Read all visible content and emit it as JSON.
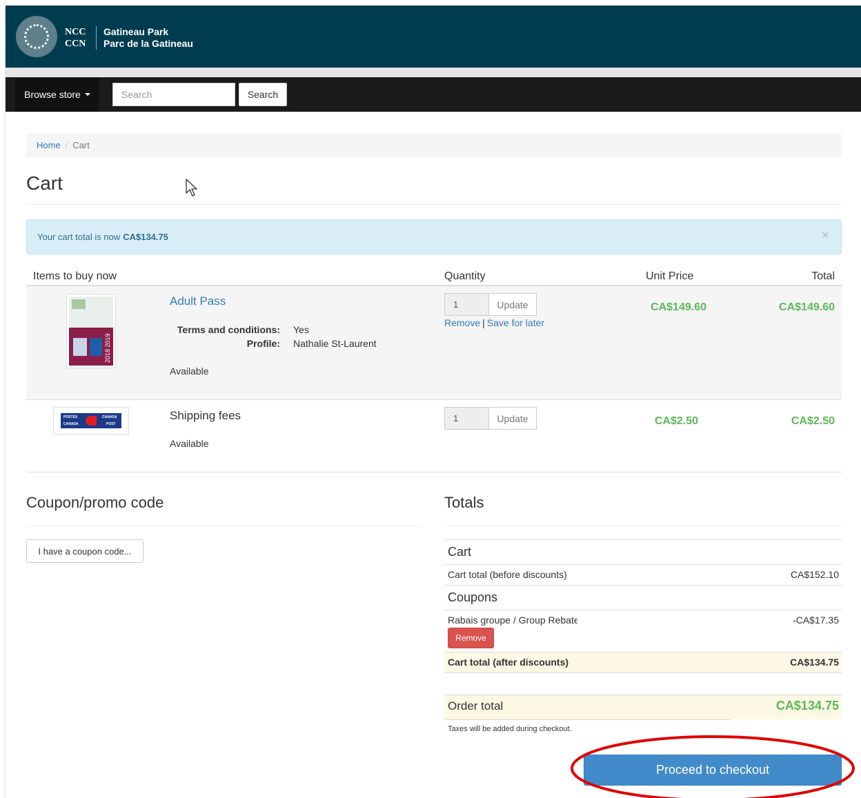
{
  "header": {
    "brand_abbr_en": "NCC",
    "brand_abbr_fr": "CCN",
    "brand_name_en": "Gatineau Park",
    "brand_name_fr": "Parc de la Gatineau",
    "logo_icon": "ncc-logo-icon",
    "color": "#003c4f"
  },
  "nav": {
    "browse_label": "Browse store",
    "search_placeholder": "Search",
    "search_button": "Search"
  },
  "breadcrumb": {
    "home": "Home",
    "separator": "/",
    "current": "Cart"
  },
  "page": {
    "title": "Cart"
  },
  "alert": {
    "text": "Your cart total is now ",
    "amount": "CA$134.75",
    "close": "×"
  },
  "table": {
    "headers": {
      "items": "Items to buy now",
      "quantity": "Quantity",
      "unit_price": "Unit Price",
      "total": "Total"
    },
    "rows": [
      {
        "name": "Adult Pass",
        "image_icon": "adult-pass-card-icon",
        "options": [
          {
            "label": "Terms and conditions:",
            "value": "Yes"
          },
          {
            "label": "Profile:",
            "value": "Nathalie St-Laurent"
          }
        ],
        "availability": "Available",
        "quantity": "1",
        "update_label": "Update",
        "remove_label": "Remove",
        "link_sep": "|",
        "save_label": "Save for later",
        "unit_price": "CA$149.60",
        "total": "CA$149.60"
      },
      {
        "name": "Shipping fees",
        "image_icon": "canada-post-logo-icon",
        "availability": "Available",
        "quantity": "1",
        "update_label": "Update",
        "unit_price": "CA$2.50",
        "total": "CA$2.50"
      }
    ],
    "price_color": "#5cb85c"
  },
  "coupon": {
    "heading": "Coupon/promo code",
    "button": "I have a coupon code..."
  },
  "totals": {
    "heading": "Totals",
    "cart_group": "Cart",
    "cart_before_label": "Cart total (before discounts)",
    "cart_before_value": "CA$152.10",
    "coupons_group": "Coupons",
    "coupon_name": "Rabais groupe / Group Rebate",
    "coupon_value": "-CA$17.35",
    "coupon_remove": "Remove",
    "cart_after_label": "Cart total (after discounts)",
    "cart_after_value": "CA$134.75",
    "order_total_label": "Order total",
    "order_total_value": "CA$134.75",
    "tax_note": "Taxes will be added during checkout."
  },
  "checkout": {
    "button": "Proceed to checkout",
    "color": "#428bca",
    "highlight_color": "#e00000"
  }
}
